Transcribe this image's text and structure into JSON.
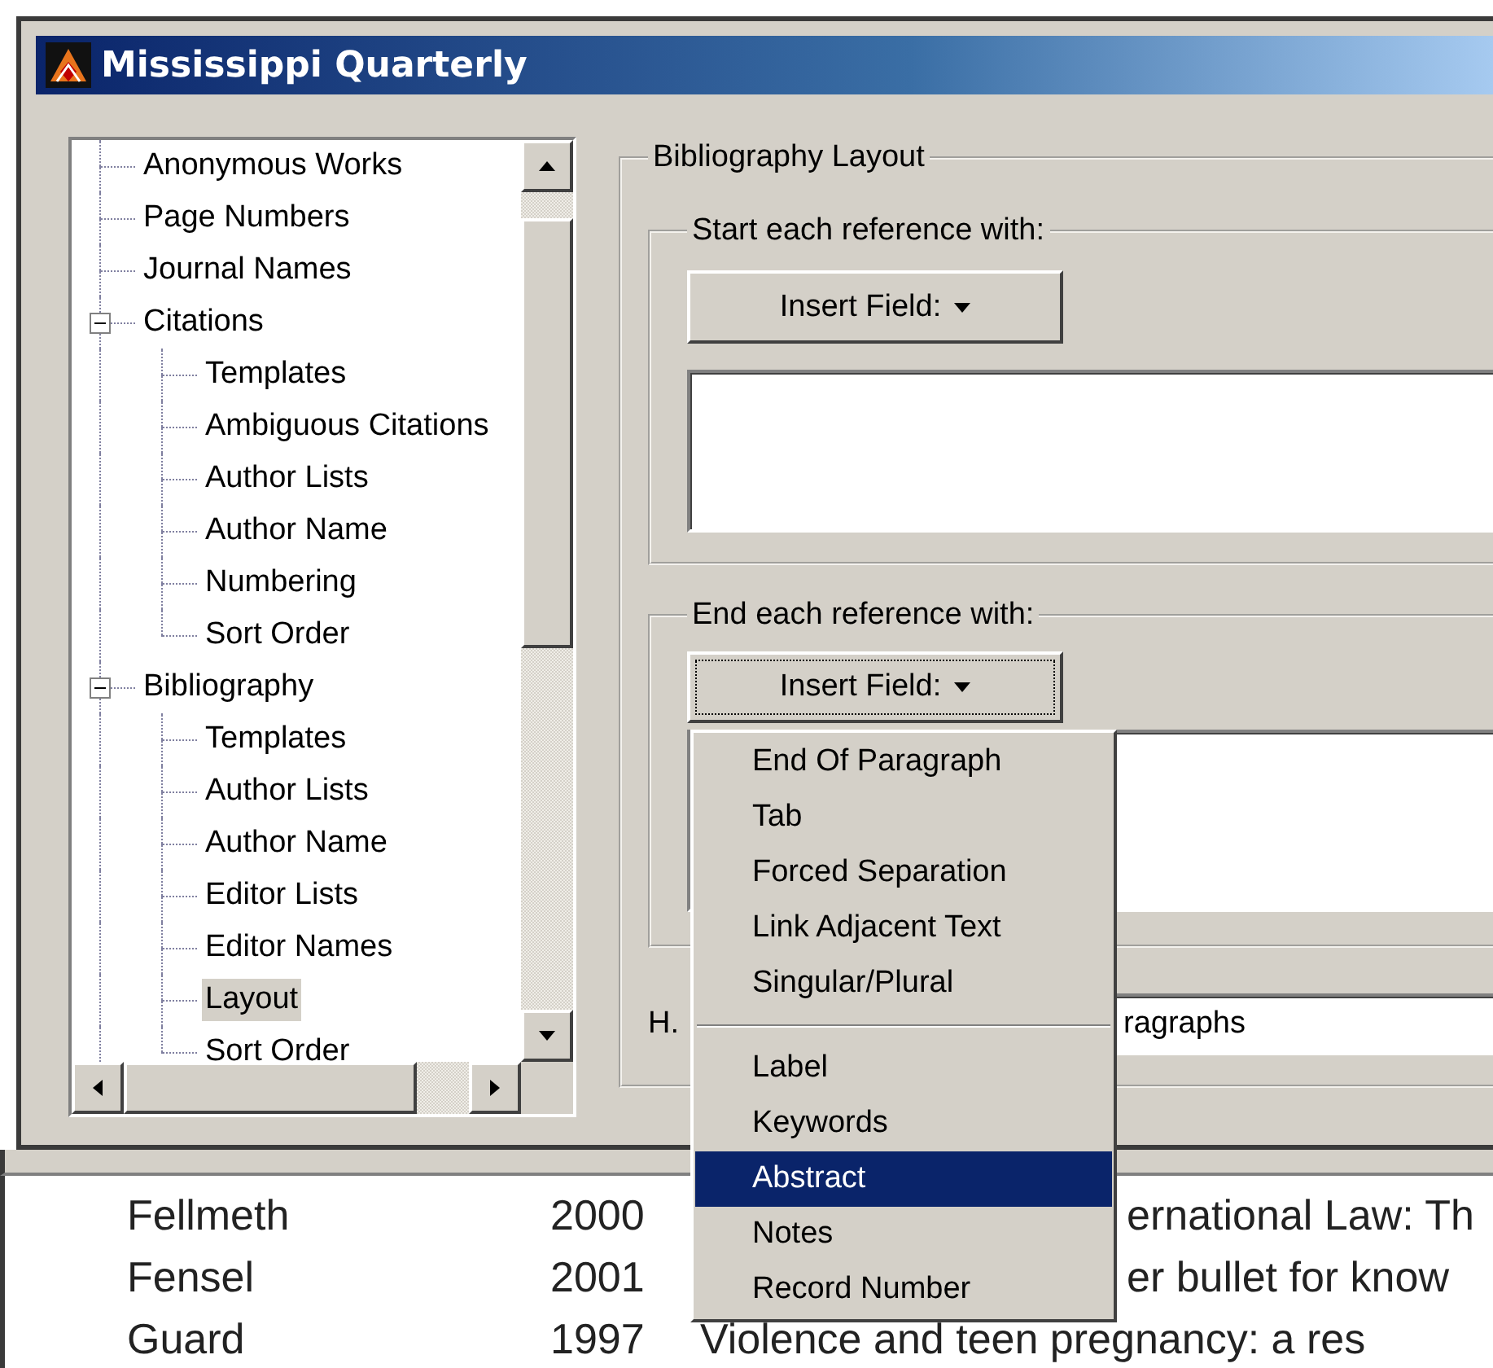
{
  "window": {
    "title": "Mississippi Quarterly"
  },
  "tree": {
    "items": [
      {
        "label": "Anonymous Works",
        "selected": false
      },
      {
        "label": "Page Numbers",
        "selected": false
      },
      {
        "label": "Journal Names",
        "selected": false
      },
      {
        "label": "Citations",
        "selected": false,
        "expanded": true,
        "children": [
          {
            "label": "Templates",
            "selected": false
          },
          {
            "label": "Ambiguous Citations",
            "selected": false
          },
          {
            "label": "Author Lists",
            "selected": false
          },
          {
            "label": "Author Name",
            "selected": false
          },
          {
            "label": "Numbering",
            "selected": false
          },
          {
            "label": "Sort Order",
            "selected": false
          }
        ]
      },
      {
        "label": "Bibliography",
        "selected": false,
        "expanded": true,
        "children": [
          {
            "label": "Templates",
            "selected": false
          },
          {
            "label": "Author Lists",
            "selected": false
          },
          {
            "label": "Author Name",
            "selected": false
          },
          {
            "label": "Editor Lists",
            "selected": false
          },
          {
            "label": "Editor Names",
            "selected": false
          },
          {
            "label": "Layout",
            "selected": true
          },
          {
            "label": "Sort Order",
            "selected": false
          }
        ]
      }
    ]
  },
  "bibliography_layout": {
    "title": "Bibliography Layout",
    "groups": [
      {
        "label": "Start each reference with:",
        "button": "Insert Field:",
        "focused": false
      },
      {
        "label": "End each reference with:",
        "button": "Insert Field:",
        "focused": true
      }
    ],
    "hanging_indent": {
      "label": "H.",
      "value": "ragraphs"
    }
  },
  "insert_field_menu": {
    "items": [
      {
        "kind": "item",
        "label": "End Of Paragraph",
        "selected": false
      },
      {
        "kind": "item",
        "label": "Tab",
        "selected": false
      },
      {
        "kind": "item",
        "label": "Forced Separation",
        "selected": false
      },
      {
        "kind": "item",
        "label": "Link Adjacent Text",
        "selected": false
      },
      {
        "kind": "item",
        "label": "Singular/Plural",
        "selected": false
      },
      {
        "kind": "separator"
      },
      {
        "kind": "item",
        "label": "Label",
        "selected": false
      },
      {
        "kind": "item",
        "label": "Keywords",
        "selected": false
      },
      {
        "kind": "item",
        "label": "Abstract",
        "selected": true
      },
      {
        "kind": "item",
        "label": "Notes",
        "selected": false
      },
      {
        "kind": "item",
        "label": "Record Number",
        "selected": false
      }
    ]
  },
  "background_list": {
    "rows": [
      {
        "author": "Fellmeth",
        "year": "2000",
        "title": "ernational Law: Th",
        "covered": true
      },
      {
        "author": "Fensel",
        "year": "2001",
        "title": "er bullet for know",
        "covered": true
      },
      {
        "author": "Guard",
        "year": "1997",
        "title": "Violence and teen pregnancy: a res",
        "covered": false
      }
    ]
  }
}
